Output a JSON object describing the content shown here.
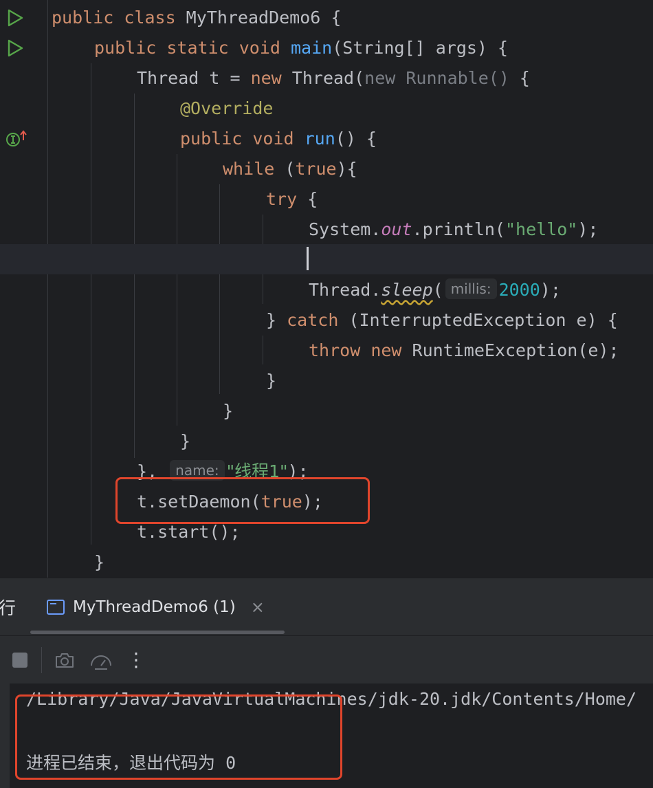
{
  "editor": {
    "lines": [
      {
        "kw1": "public class ",
        "name": "MyThreadDemo6 {"
      },
      {
        "kw1": "public static void ",
        "fn": "main",
        "rest": "(String[] args) {"
      },
      {
        "a": "Thread t = ",
        "kw": "new ",
        "b": "Thread(",
        "dim": "new Runnable()",
        "c": " {"
      },
      {
        "annotation": "@Override"
      },
      {
        "kw1": "public void ",
        "fn": "run",
        "rest": "() {"
      },
      {
        "kw": "while ",
        "rest1": "(",
        "kw2": "true",
        "rest2": "){"
      },
      {
        "kw": "try ",
        "rest": "{"
      },
      {
        "a": "System.",
        "field": "out",
        "b": ".println(",
        "str": "\"hello\"",
        "c": ");"
      },
      {
        "a": ""
      },
      {
        "a": "Thread.",
        "method": "sleep",
        "b": "(",
        "hint": "millis:",
        "num": "2000",
        "c": ");"
      },
      {
        "a": "} ",
        "kw": "catch ",
        "b": "(InterruptedException e) {"
      },
      {
        "kw1": "throw ",
        "kw2": "new ",
        "rest": "RuntimeException(e);"
      },
      {
        "a": "}"
      },
      {
        "a": "}"
      },
      {
        "a": "}"
      },
      {
        "a": "}, ",
        "hint": "name:",
        "str": "\"线程1\"",
        "c": ");"
      },
      {
        "a": "t.setDaemon(",
        "kw": "true",
        "c": ");"
      },
      {
        "a": "t.start();"
      },
      {
        "a": "}"
      }
    ]
  },
  "gutter_icons": [
    "run-icon",
    "run-icon",
    "implements-icon"
  ],
  "run_tab": {
    "left_char": "行",
    "label": "MyThreadDemo6 (1)",
    "close": "×"
  },
  "toolbar": {
    "more": "⋮"
  },
  "console": {
    "line1": "/Library/Java/JavaVirtualMachines/jdk-20.jdk/Contents/Home/",
    "exit_text": "进程已结束，退出代码为",
    "exit_code": "0"
  },
  "colors": {
    "keyword": "#cf8e6d",
    "function": "#56a8f5",
    "string": "#6aab73",
    "number": "#2aacb8",
    "highlight_box": "#e0452c"
  }
}
